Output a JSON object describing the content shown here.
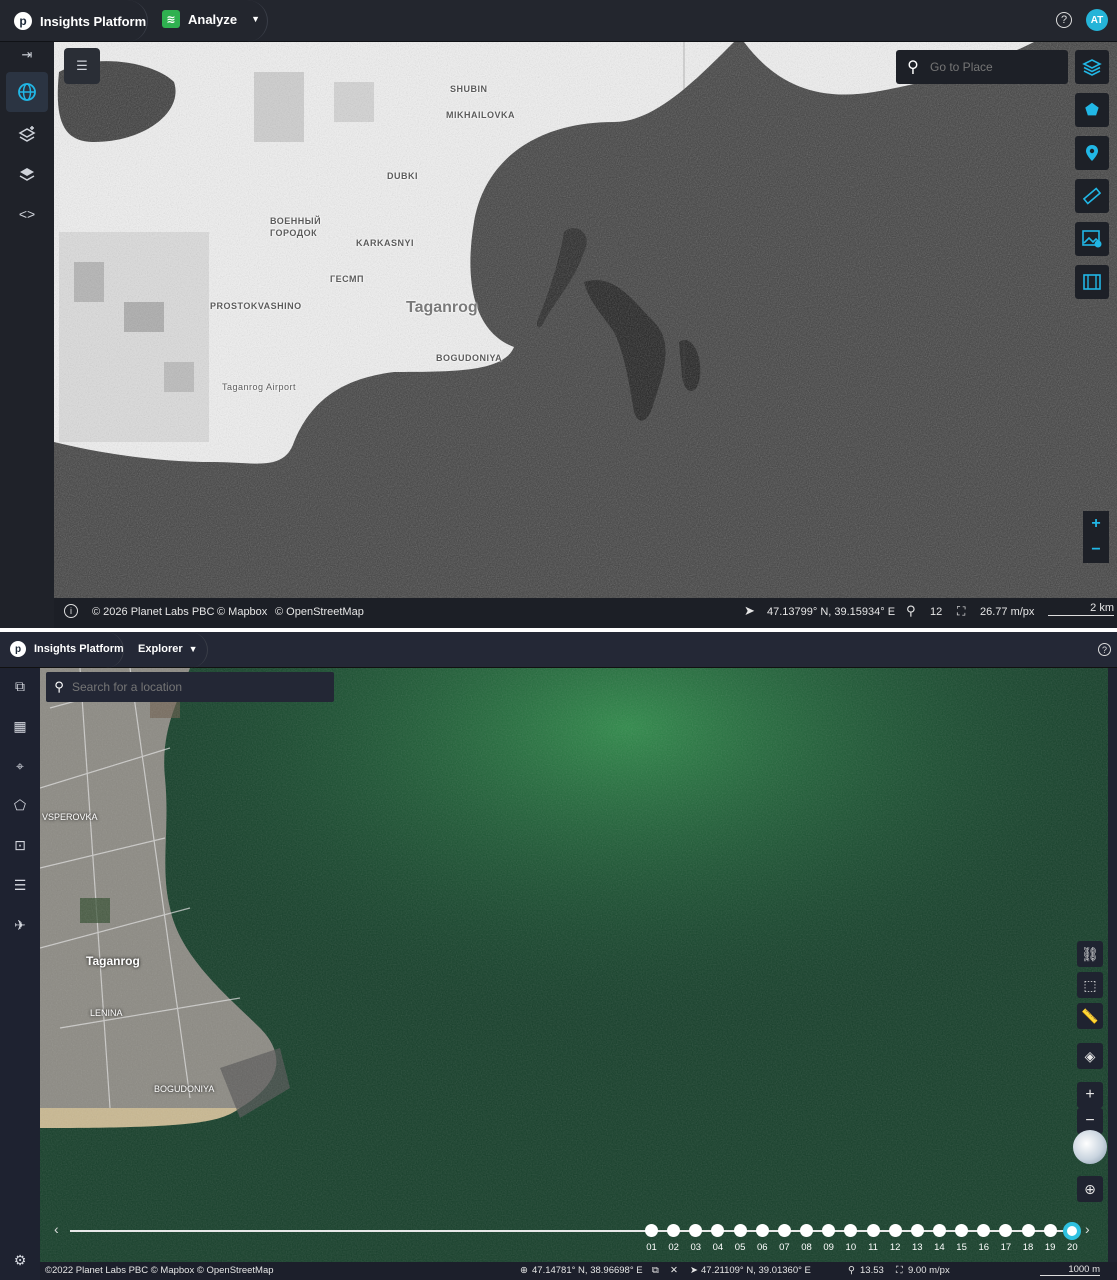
{
  "panel_a": {
    "brand": "Insights Platform",
    "mode_label": "Analyze",
    "avatar_initials": "AT",
    "search_placeholder": "Go to Place",
    "map_labels": {
      "shubin": "SHUBIN",
      "mikhailovka": "MIKHAILOVKA",
      "dubki": "DUBKI",
      "voenny": "ВОЕННЫЙ",
      "gorodok": "ГОРОДОК",
      "karkasnyi": "KARKASNYI",
      "gesmp": "ГЕСМП",
      "taganrog": "Taganrog",
      "prostokvashino": "PROSTOKVASHINO",
      "bogudoniya": "BOGUDONIYA",
      "airport": "Taganrog Airport"
    },
    "status": {
      "copyright": "© 2026 Planet Labs PBC",
      "mapbox": "© Mapbox",
      "osm": "© OpenStreetMap",
      "coords": "47.13799° N, 39.15934° E",
      "zoom": "12",
      "resolution": "26.77 m/px",
      "scale": "2 km"
    }
  },
  "panel_b": {
    "brand": "Insights Platform",
    "mode_label": "Explorer",
    "search_placeholder": "Search for a location",
    "map_labels": {
      "taganrog": "Taganrog",
      "lenina": "LENINA",
      "bogudoniya": "BOGUDONIYA",
      "vsperovka": "VSPEROVKA"
    },
    "timeline": [
      "01",
      "02",
      "03",
      "04",
      "05",
      "06",
      "07",
      "08",
      "09",
      "10",
      "11",
      "12",
      "13",
      "14",
      "15",
      "16",
      "17",
      "18",
      "19",
      "20"
    ],
    "timeline_active": "20",
    "status": {
      "copyright": "©2022 Planet Labs PBC © Mapbox © OpenStreetMap",
      "coords_a": "47.14781° N, 38.96698° E",
      "coords_b": "47.21109° N, 39.01360° E",
      "zoom": "13.53",
      "resolution": "9.00 m/px",
      "scale": "1000 m"
    }
  },
  "colors": {
    "accent": "#21b7e6",
    "analyze_green": "#2fb150",
    "sea_green": "#14462c"
  }
}
